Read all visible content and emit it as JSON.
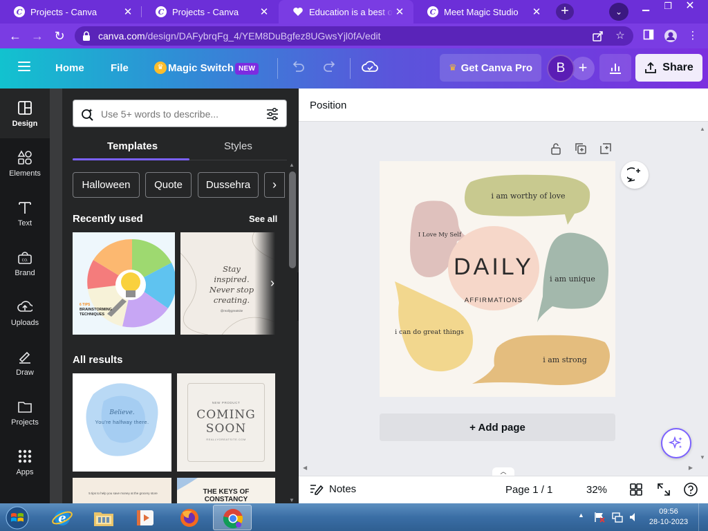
{
  "browser": {
    "tabs": [
      {
        "title": "Projects - Canva",
        "active": false
      },
      {
        "title": "Projects - Canva",
        "active": false
      },
      {
        "title": "Education is a best one -",
        "active": true
      },
      {
        "title": "Meet Magic Studio",
        "active": false
      }
    ],
    "new_tab_glyph": "+",
    "close_glyph": "✕",
    "url_host": "canva.com",
    "url_path": "/design/DAFybrqFg_4/YEM8DuBgfez8UGwsYjl0fA/edit"
  },
  "canva": {
    "nav": {
      "home": "Home",
      "file": "File",
      "magic_switch": "Magic Switch",
      "new_badge": "NEW"
    },
    "get_pro": "Get Canva Pro",
    "avatar_initial": "B",
    "share": "Share",
    "rail": [
      {
        "label": "Design",
        "icon": "design-icon"
      },
      {
        "label": "Elements",
        "icon": "elements-icon"
      },
      {
        "label": "Text",
        "icon": "text-icon"
      },
      {
        "label": "Brand",
        "icon": "brand-icon"
      },
      {
        "label": "Uploads",
        "icon": "uploads-icon"
      },
      {
        "label": "Draw",
        "icon": "draw-icon"
      },
      {
        "label": "Projects",
        "icon": "projects-icon"
      },
      {
        "label": "Apps",
        "icon": "apps-icon"
      }
    ],
    "panel": {
      "search_placeholder": "Use 5+ words to describe...",
      "tabs": [
        "Templates",
        "Styles"
      ],
      "chips": [
        "Halloween",
        "Quote",
        "Dussehra"
      ],
      "recently_used": "Recently used",
      "see_all": "See all",
      "all_results": "All results",
      "thumb_infographic": {
        "tag": "6 TIPS",
        "title": "BRAINSTORMING TECHNIQUES"
      },
      "thumb_quote": {
        "text": "Stay inspired. Never stop creating.",
        "handle": "@reallygreatsite"
      },
      "thumb_believe": {
        "line1": "Believe.",
        "line2": "You're halfway there."
      },
      "thumb_coming": {
        "small": "NEW PRODUCT",
        "title1": "COMING",
        "title2": "SOON",
        "url": "REALLYGREATSITE.COM"
      },
      "thumb_grocery": {
        "text": "5 tips to help you save money at the grocery store"
      },
      "thumb_keys": {
        "line1": "THE KEYS OF",
        "line2": "CONSTANCY"
      }
    },
    "editor": {
      "position_label": "Position",
      "add_page": "+ Add page",
      "design": {
        "title": "DAILY",
        "subtitle": "AFFIRMATIONS",
        "bubbles": [
          "i am worthy of love",
          "I Love My Self",
          "i am unique",
          "i can do great things",
          "i am strong"
        ]
      }
    },
    "footer": {
      "notes": "Notes",
      "page_indicator": "Page 1 / 1",
      "zoom": "32%"
    }
  },
  "taskbar": {
    "apps": [
      "internet-explorer-icon",
      "file-explorer-icon",
      "media-player-icon",
      "firefox-icon",
      "chrome-icon"
    ],
    "time": "09:56",
    "date": "28-10-2023"
  },
  "colors": {
    "browser_purple": "#7a3ce3",
    "panel_dark": "#252627",
    "rail_dark": "#18191b",
    "accent_violet": "#7b61ff",
    "bubble_olive": "#c8c98f",
    "bubble_pink": "#dfc1bd",
    "bubble_peach": "#f6d7c9",
    "bubble_teal": "#a3b8ac",
    "bubble_yellow": "#f2d78e",
    "bubble_orange": "#e4bd7e"
  }
}
